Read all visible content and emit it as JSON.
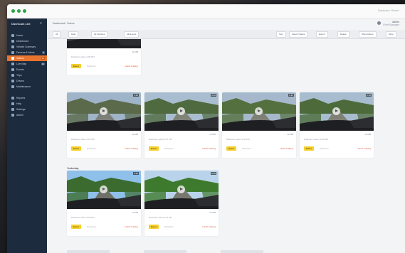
{
  "window": {
    "title": "Dashcam Viewer"
  },
  "sidebar": {
    "brand": "DashCam Lite",
    "collapse": "≡",
    "items": [
      {
        "label": "Home",
        "icon": "home-icon",
        "badge": ""
      },
      {
        "label": "Dashboard",
        "icon": "dashboard-icon",
        "badge": ""
      },
      {
        "label": "Vehicle Summary",
        "icon": "car-icon",
        "badge": ""
      },
      {
        "label": "Devices & Alerts",
        "icon": "bell-icon",
        "badge": "6"
      },
      {
        "label": "Videos",
        "icon": "video-icon",
        "badge": "34"
      },
      {
        "label": "Live Map",
        "icon": "map-icon",
        "badge": "12"
      },
      {
        "label": "Events",
        "icon": "flag-icon",
        "badge": ""
      },
      {
        "label": "Trips",
        "icon": "route-icon",
        "badge": ""
      },
      {
        "label": "Drivers",
        "icon": "user-icon",
        "badge": ""
      },
      {
        "label": "Maintenance",
        "icon": "wrench-icon",
        "badge": ""
      },
      {
        "label": "Reports",
        "icon": "chart-icon",
        "badge": ""
      },
      {
        "label": "Help",
        "icon": "help-icon",
        "badge": ""
      },
      {
        "label": "Settings",
        "icon": "gear-icon",
        "badge": ""
      },
      {
        "label": "Admin",
        "icon": "shield-icon",
        "badge": ""
      }
    ]
  },
  "header": {
    "breadcrumb": "Dashboard  /  Videos",
    "user_name": "Admin",
    "user_role": "Fleet Manager"
  },
  "toolbar": {
    "filters": [
      "All",
      "Date",
      "All Vehicles",
      "All Events"
    ],
    "right": [
      "Sort",
      "Select Videos",
      "Export",
      "Delete",
      "Show Filters",
      "More"
    ]
  },
  "sections": {
    "second": "Yesterday"
  },
  "cards": [
    {
      "caption": "Dashcam video  4:06 PM",
      "tag": "Event",
      "sub": "Dashcam",
      "red": "Harsh braking",
      "dur": "0:30",
      "meta": "12 MB"
    },
    {
      "caption": "Dashcam video  3:12 PM",
      "tag": "Event",
      "sub": "Dashcam",
      "red": "Harsh braking",
      "dur": "0:30",
      "meta": "12 MB"
    },
    {
      "caption": "Dashcam video  2:47 PM",
      "tag": "Event",
      "sub": "Dashcam",
      "red": "Harsh braking",
      "dur": "0:30",
      "meta": "12 MB"
    },
    {
      "caption": "Dashcam video  1:20 PM",
      "tag": "Event",
      "sub": "Dashcam",
      "red": "Harsh braking",
      "dur": "0:30",
      "meta": "12 MB"
    },
    {
      "caption": "Dashcam video  11:05 AM",
      "tag": "Event",
      "sub": "Dashcam",
      "red": "Harsh braking",
      "dur": "0:30",
      "meta": "12 MB"
    },
    {
      "caption": "Dashcam video  9:38 AM",
      "tag": "Event",
      "sub": "Dashcam",
      "red": "Harsh braking",
      "dur": "0:30",
      "meta": "12 MB"
    },
    {
      "caption": "Dashcam video  8:14 AM",
      "tag": "Event",
      "sub": "Dashcam",
      "red": "Harsh braking",
      "dur": "0:30",
      "meta": "12 MB"
    }
  ],
  "colors": {
    "sidebar": "#1d2b3f",
    "active": "#e8742e",
    "tag": "#f6cf2a",
    "alert": "#e05a3c",
    "traffic": "#2aa34a"
  }
}
